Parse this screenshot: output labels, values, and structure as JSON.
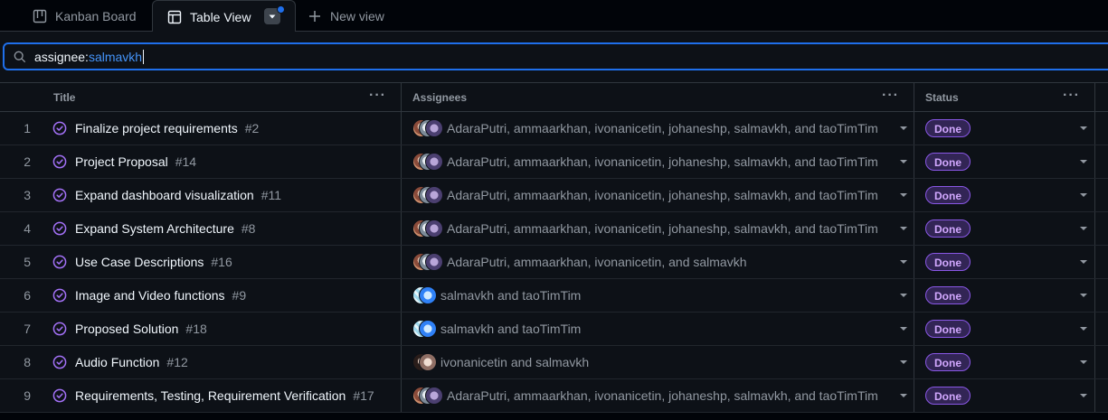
{
  "tabs": {
    "kanban": {
      "label": "Kanban Board",
      "icon": "board-icon"
    },
    "table": {
      "label": "Table View",
      "icon": "table-icon"
    },
    "new_view": {
      "label": "New view",
      "icon": "plus-icon"
    }
  },
  "filter": {
    "key": "assignee:",
    "value": "salmavkh"
  },
  "columns": {
    "title": "Title",
    "assignees": "Assignees",
    "status": "Status"
  },
  "colors": {
    "accent": "#1f6feb",
    "done_badge": "#8957e5",
    "issue_closed": "#a371f7"
  },
  "rows": [
    {
      "num": "1",
      "title": "Finalize project requirements",
      "issue": "#2",
      "avatars": [
        "user-a",
        "user-b",
        "user-c"
      ],
      "assignees": "AdaraPutri, ammaarkhan, ivonanicetin, johaneshp, salmavkh, and taoTimTim",
      "status": "Done"
    },
    {
      "num": "2",
      "title": "Project Proposal",
      "issue": "#14",
      "avatars": [
        "user-a",
        "user-b",
        "user-c"
      ],
      "assignees": "AdaraPutri, ammaarkhan, ivonanicetin, johaneshp, salmavkh, and taoTimTim",
      "status": "Done"
    },
    {
      "num": "3",
      "title": "Expand dashboard visualization",
      "issue": "#11",
      "avatars": [
        "user-a",
        "user-b",
        "user-c"
      ],
      "assignees": "AdaraPutri, ammaarkhan, ivonanicetin, johaneshp, salmavkh, and taoTimTim",
      "status": "Done"
    },
    {
      "num": "4",
      "title": "Expand System Architecture",
      "issue": "#8",
      "avatars": [
        "user-a",
        "user-b",
        "user-c"
      ],
      "assignees": "AdaraPutri, ammaarkhan, ivonanicetin, johaneshp, salmavkh, and taoTimTim",
      "status": "Done"
    },
    {
      "num": "5",
      "title": "Use Case Descriptions",
      "issue": "#16",
      "avatars": [
        "user-a",
        "user-b",
        "user-c"
      ],
      "assignees": "AdaraPutri, ammaarkhan, ivonanicetin, and salmavkh",
      "status": "Done"
    },
    {
      "num": "6",
      "title": "Image and Video functions",
      "issue": "#9",
      "avatars": [
        "user-d",
        "user-e"
      ],
      "assignees": "salmavkh and taoTimTim",
      "status": "Done"
    },
    {
      "num": "7",
      "title": "Proposed Solution",
      "issue": "#18",
      "avatars": [
        "user-d",
        "user-e"
      ],
      "assignees": "salmavkh and taoTimTim",
      "status": "Done"
    },
    {
      "num": "8",
      "title": "Audio Function",
      "issue": "#12",
      "avatars": [
        "user-f",
        "user-g"
      ],
      "assignees": "ivonanicetin and salmavkh",
      "status": "Done"
    },
    {
      "num": "9",
      "title": "Requirements, Testing, Requirement Verification",
      "issue": "#17",
      "avatars": [
        "user-a",
        "user-b",
        "user-c"
      ],
      "assignees": "AdaraPutri, ammaarkhan, ivonanicetin, johaneshp, salmavkh, and taoTimTim",
      "status": "Done"
    }
  ]
}
